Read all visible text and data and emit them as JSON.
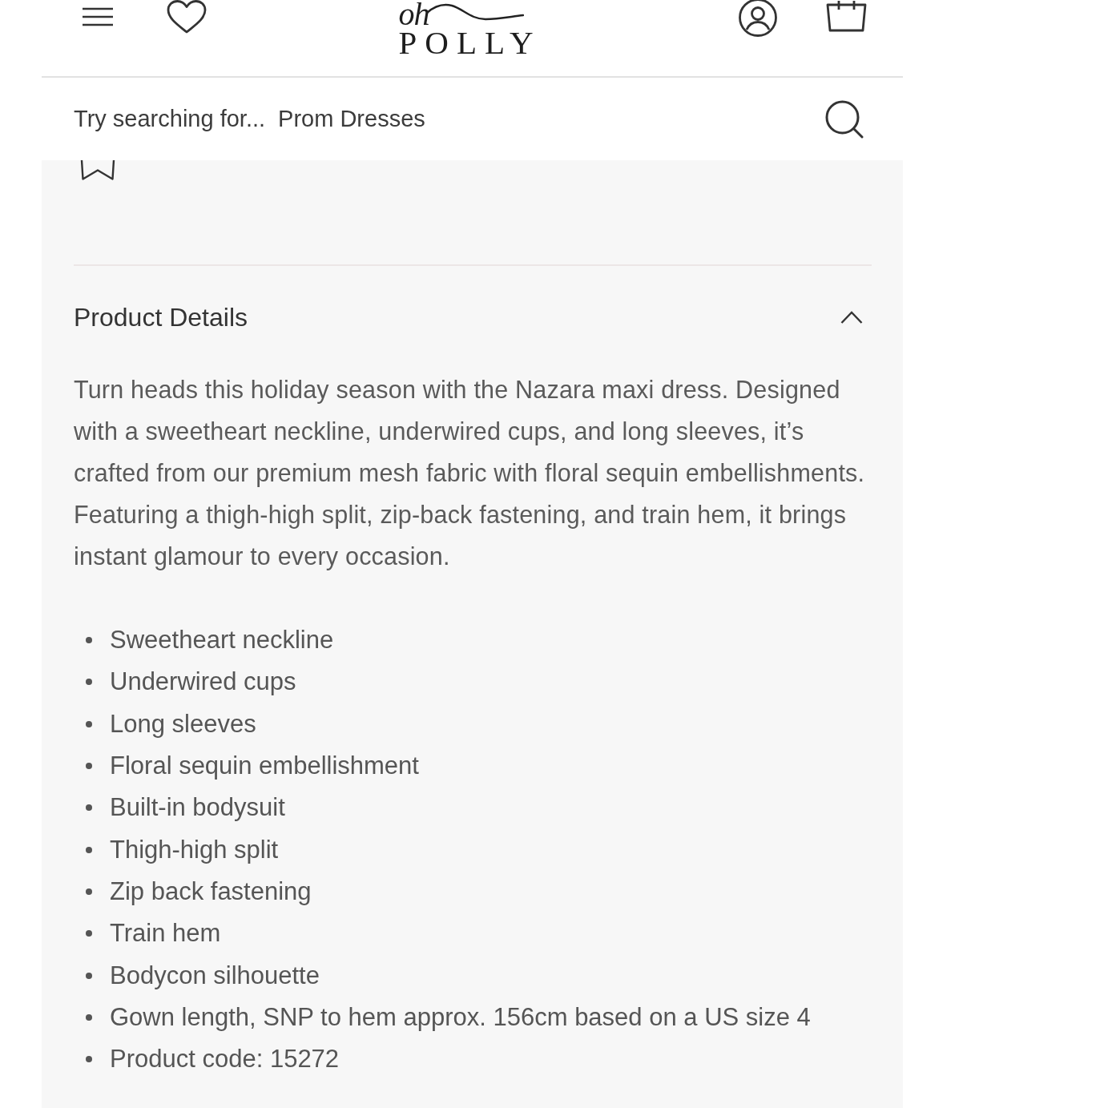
{
  "header": {
    "logo": {
      "script": "oh",
      "wordmark": "POLLY"
    }
  },
  "search": {
    "placeholder": "Try searching for...",
    "suggestion": "Prom Dresses"
  },
  "product_details": {
    "title": "Product Details",
    "expanded": true,
    "description": "Turn heads this holiday season with the Nazara maxi dress. Designed with a sweetheart neckline, underwired cups, and long sleeves, it’s crafted from our premium mesh fabric with floral sequin embellishments. Featuring a thigh-high split, zip-back fastening, and train hem, it brings instant glamour to every occasion.",
    "features": [
      "Sweetheart neckline",
      "Underwired cups",
      "Long sleeves",
      "Floral sequin embellishment",
      "Built-in bodysuit",
      "Thigh-high split",
      "Zip back fastening",
      "Train hem",
      "Bodycon silhouette",
      "Gown length, SNP to hem approx. 156cm based on a US size 4",
      "Product code: 15272"
    ]
  }
}
